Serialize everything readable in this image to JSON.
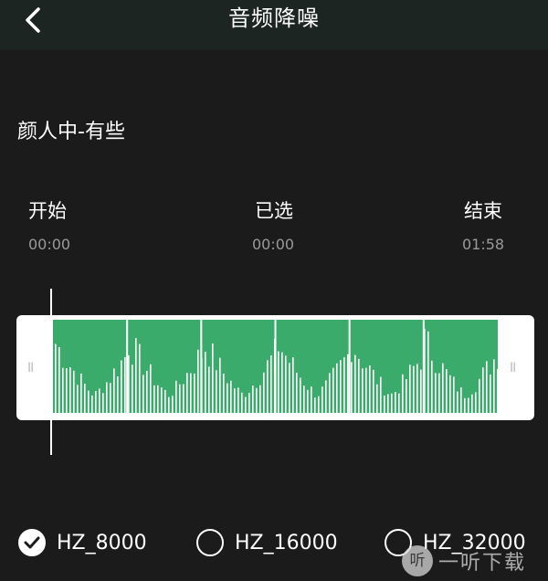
{
  "header": {
    "title": "音频降噪",
    "back_icon": "chevron-left-icon"
  },
  "song_title": "颜人中-有些",
  "selection": {
    "start": {
      "label": "开始",
      "time": "00:00"
    },
    "selected": {
      "label": "已选",
      "time": "00:00"
    },
    "end": {
      "label": "结束",
      "time": "01:58"
    }
  },
  "waveform": {
    "handle_left": "II",
    "handle_right": "II",
    "color": "#3aab6b"
  },
  "options": [
    {
      "label": "HZ_8000",
      "selected": true
    },
    {
      "label": "HZ_16000",
      "selected": false
    },
    {
      "label": "HZ_32000",
      "selected": false
    }
  ],
  "watermark": {
    "logo_text": "听",
    "text": "一听下载"
  }
}
